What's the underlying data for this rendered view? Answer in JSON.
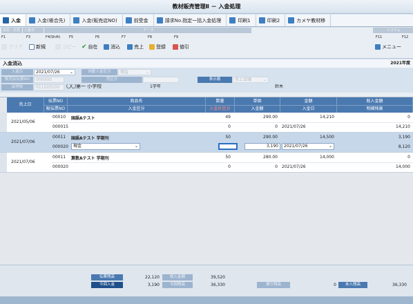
{
  "app": {
    "title": "教材販売管理Ⅱ － 入金処理"
  },
  "tabs": [
    {
      "label": "入金",
      "active": true
    },
    {
      "label": "入金(帳合先)",
      "active": false
    },
    {
      "label": "入金(販売店NO)",
      "active": false
    },
    {
      "label": "前受金",
      "active": false
    },
    {
      "label": "請求No.指定一括入金処理",
      "active": false
    },
    {
      "label": "印刷1",
      "active": false
    },
    {
      "label": "印刷2",
      "active": false
    },
    {
      "label": "カメヤ教材移",
      "active": false
    }
  ],
  "fkeys": {
    "headers": [
      "前頁・次頁",
      "入金日",
      "データ",
      "システム"
    ],
    "codes": [
      "F1",
      "F3",
      "F4(Shift)",
      "F5",
      "F6",
      "F7",
      "F8",
      "F9",
      "F11",
      "F12"
    ],
    "buttons": [
      {
        "label": "クリア",
        "icon": "clear-icon",
        "enabled": false
      },
      {
        "label": "新規",
        "icon": "new-document-icon",
        "enabled": true
      },
      {
        "label": "コピー",
        "icon": "copy-icon",
        "enabled": false
      },
      {
        "label": "自在",
        "icon": "checkmark-icon",
        "enabled": true
      },
      {
        "label": "消込",
        "icon": "reconcile-icon",
        "enabled": true
      },
      {
        "label": "売上",
        "icon": "sales-icon",
        "enabled": true
      },
      {
        "label": "登録",
        "icon": "register-icon",
        "enabled": true
      },
      {
        "label": "値引",
        "icon": "discount-icon",
        "enabled": true
      },
      {
        "label": "メニュー",
        "icon": "menu-icon",
        "enabled": true
      }
    ]
  },
  "section": {
    "title": "入金消込",
    "date_partial": "2021年度"
  },
  "header_fields": {
    "nyukin_bi_label": "入金日",
    "nyukin_bi_value": "2021/07/26",
    "jido_label": "自動入金区分",
    "jido_value": "現金",
    "hanbaiten_label": "販売店伝票NO",
    "hanbaiten_value": "000000",
    "kubun_label": "売区分",
    "kubun_value": "",
    "hyoji_label": "表示順",
    "hyoji_value": "売上日順",
    "gakko_label": "出学校",
    "gakko_code": "011020100",
    "gakko_name": "〇〇第一 小学校",
    "grade": "1学年",
    "teacher": "鈴木"
  },
  "grid": {
    "columns": {
      "uriagebi": "売上日",
      "denpyo_top": "伝票NO",
      "denpyo_bottom": "販伝票NO",
      "shohin_top": "商品名",
      "shohin_bottom": "入金区分",
      "suryo_top": "数量",
      "suryo_bottom": "入金計区分",
      "tanka_top": "単価",
      "tanka_bottom": "入金額",
      "kingaku_top": "金額",
      "kingaku_bottom": "入金日",
      "zan_top": "既入金額",
      "zan_bottom": "明細残高"
    },
    "rows": [
      {
        "date": "2021/05/06",
        "slip": "00010",
        "slip2": "000015",
        "product": "国語Aテスト",
        "kubun": "",
        "qty": "49",
        "qty2": "0",
        "price": "290.00",
        "paid": "0",
        "amount": "14,210",
        "paid_date": "2021/07/26",
        "prev": "0",
        "balance": "14,210",
        "selected": false
      },
      {
        "date": "2021/07/06",
        "slip": "00011",
        "slip2": "000020",
        "product": "国語Aテスト 学期刊",
        "kubun": "現金",
        "qty": "50",
        "qty2": "",
        "price": "290.00",
        "paid": "3,190",
        "amount": "14,500",
        "paid_date": "2021/07/26",
        "prev": "3,190",
        "balance": "8,120",
        "selected": true
      },
      {
        "date": "2021/07/06",
        "slip": "00011",
        "slip2": "000020",
        "product": "算数Aテスト 学期刊",
        "kubun": "",
        "qty": "50",
        "qty2": "0",
        "price": "280.00",
        "paid": "0",
        "amount": "14,000",
        "paid_date": "2021/07/26",
        "prev": "0",
        "balance": "14,000",
        "selected": false
      }
    ]
  },
  "footer": {
    "shukei_label": "伝票残高",
    "shukei_value": "22,120",
    "kizai_label": "既入金額",
    "kizai_value": "39,520",
    "konkai_label": "今回入金",
    "konkai_value": "3,190",
    "konzan_label": "今回残高",
    "konzan_value": "36,330",
    "furikomi_label": "振り残高",
    "furikomi_value": "0",
    "zan_label": "未入残高",
    "zan_value": "36,330"
  },
  "colors": {
    "header_blue": "#4a79b0",
    "selected_row": "#c6d7ea",
    "tab_icon": "#3d7fc1"
  }
}
